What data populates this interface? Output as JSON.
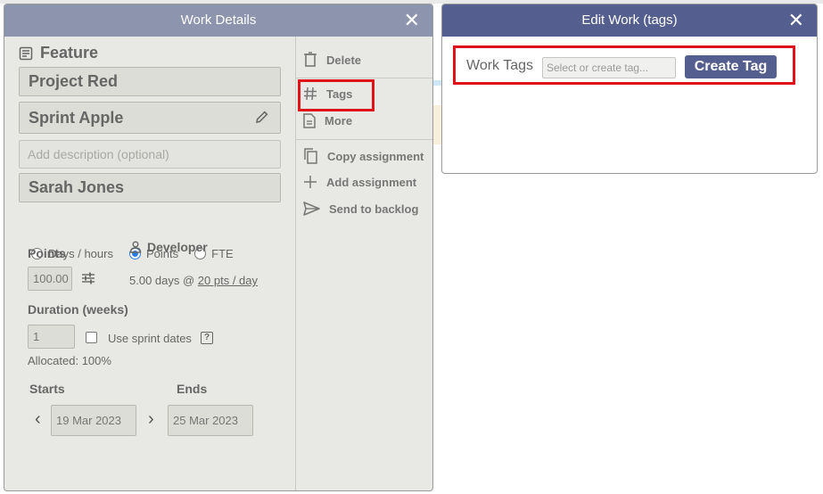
{
  "work_details": {
    "title": "Work Details",
    "feature_label": "Feature",
    "project": "Project Red",
    "sprint": "Sprint Apple",
    "description_placeholder": "Add description (optional)",
    "assignee": "Sarah Jones",
    "radio_options": [
      "Days / hours",
      "Points",
      "FTE"
    ],
    "selected_option": "Points",
    "points_label": "Points",
    "points_value": "100.00",
    "role": "Developer",
    "rate_prefix": "5.00 days @ ",
    "rate_link": "20 pts / day",
    "duration_label": "Duration (weeks)",
    "duration_value": "1",
    "use_sprint_dates": "Use sprint dates",
    "help_glyph": "?",
    "allocated": "Allocated: 100%",
    "starts_label": "Starts",
    "ends_label": "Ends",
    "start_date": "19 Mar 2023",
    "end_date": "25 Mar 2023",
    "prev_glyph": "‹",
    "next_glyph": "›",
    "menu": {
      "delete": "Delete",
      "tags": "Tags",
      "more": "More",
      "copy": "Copy assignment",
      "add": "Add assignment",
      "backlog": "Send to backlog"
    },
    "close_glyph": "✕"
  },
  "edit_work": {
    "title": "Edit Work (tags)",
    "tags_label": "Work Tags",
    "tags_placeholder": "Select or create tag...",
    "create_button": "Create Tag",
    "close_glyph": "✕"
  },
  "icons": [
    "document-icon",
    "pencil-icon",
    "person-icon",
    "sliders-icon",
    "trash-icon",
    "hash-icon",
    "copy-icon",
    "plus-icon",
    "send-icon",
    "close-icon",
    "chevron-left-icon",
    "chevron-right-icon",
    "help-icon"
  ]
}
